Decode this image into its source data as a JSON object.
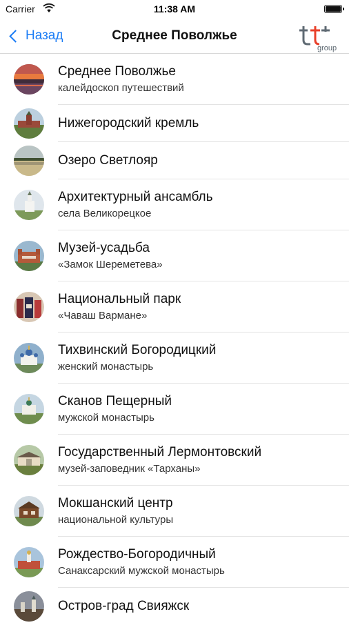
{
  "status_bar": {
    "carrier": "Carrier",
    "time": "11:38 AM"
  },
  "nav": {
    "back_label": "Назад",
    "title": "Среднее Поволжье",
    "logo_text": "group"
  },
  "colors": {
    "accent": "#1a7cf5",
    "logo_red": "#e8402a",
    "logo_gray": "#5f6a73"
  },
  "items": [
    {
      "title": "Среднее Поволжье",
      "subtitle": "калейдоскоп путешествий",
      "thumb": "sunset-river"
    },
    {
      "title": "Нижегородский кремль",
      "subtitle": "",
      "thumb": "kremlin-walls"
    },
    {
      "title": "Озеро Светлояр",
      "subtitle": "",
      "thumb": "lake"
    },
    {
      "title": "Архитектурный ансамбль",
      "subtitle": "села Великорецкое",
      "thumb": "white-church"
    },
    {
      "title": "Музей-усадьба",
      "subtitle": "«Замок Шереметева»",
      "thumb": "castle"
    },
    {
      "title": "Национальный парк",
      "subtitle": "«Чаваш Вармане»",
      "thumb": "costumes"
    },
    {
      "title": "Тихвинский Богородицкий",
      "subtitle": "женский монастырь",
      "thumb": "monastery-blue"
    },
    {
      "title": "Сканов Пещерный",
      "subtitle": "мужской монастырь",
      "thumb": "monastery-green"
    },
    {
      "title": "Государственный Лермонтовский",
      "subtitle": "музей-заповедник «Тарханы»",
      "thumb": "manor"
    },
    {
      "title": "Мокшанский центр",
      "subtitle": "национальной культуры",
      "thumb": "wooden-house"
    },
    {
      "title": "Рождество-Богородичный",
      "subtitle": "Санаксарский мужской монастырь",
      "thumb": "red-monastery"
    },
    {
      "title": "Остров-град Свияжск",
      "subtitle": "",
      "thumb": "island-town"
    }
  ]
}
